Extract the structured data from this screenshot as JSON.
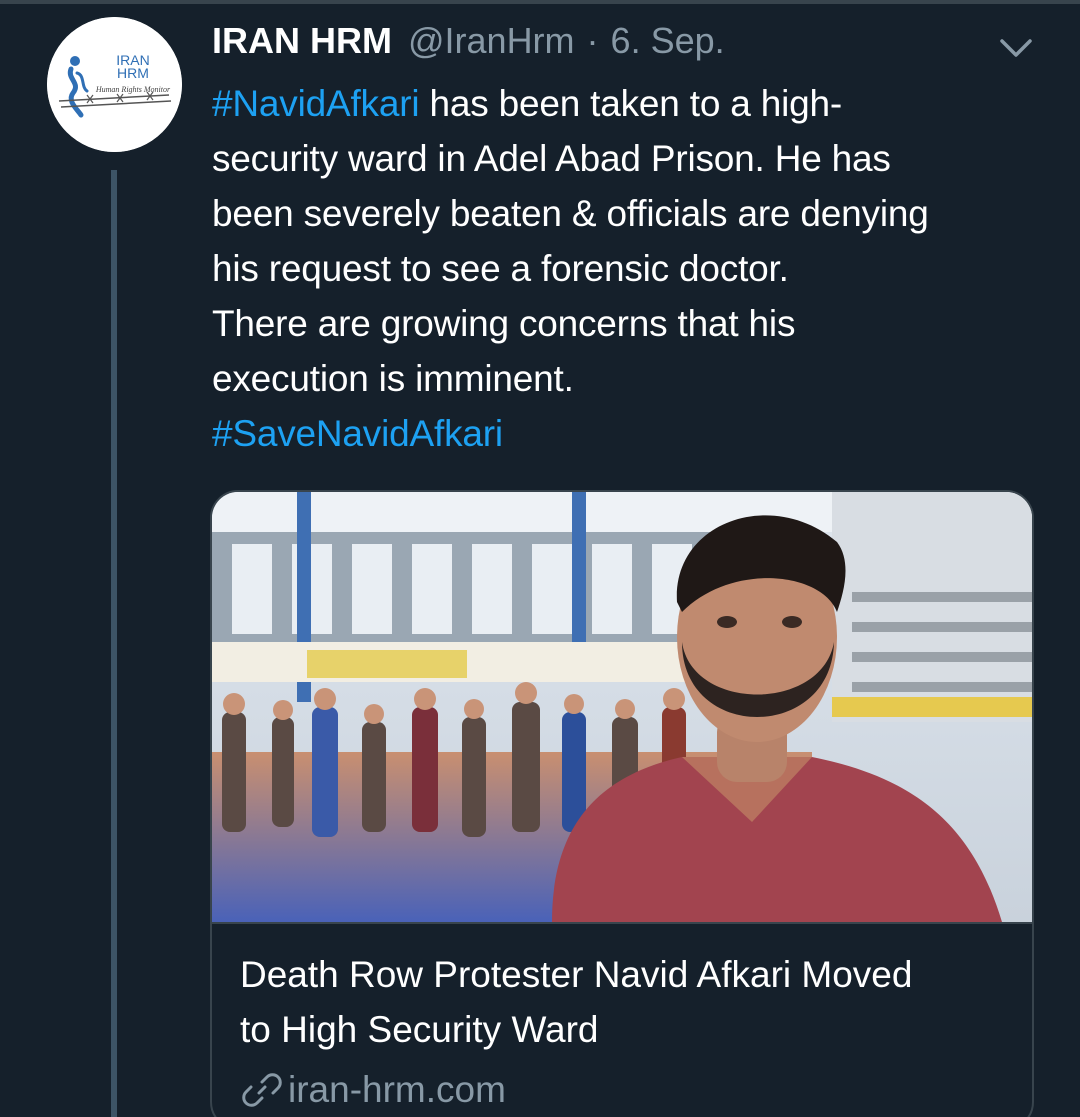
{
  "tweet": {
    "author": {
      "name": "IRAN HRM",
      "handle": "@IranHrm",
      "avatar_lines": [
        "IRAN",
        "HRM"
      ],
      "avatar_subtitle": "Human Rights Monitor"
    },
    "separator": "·",
    "date": "6. Sep.",
    "text_lines": {
      "l1_hashtag": "#NavidAfkari",
      "l1_rest": " has been taken to a high-",
      "l2": "security ward in Adel Abad Prison. He has",
      "l3": "been severely beaten & officials are denying",
      "l4": "his request to see a forensic doctor.",
      "l5": "There are growing concerns that his",
      "l6": "execution is imminent.",
      "l7_hashtag": "#SaveNavidAfkari"
    },
    "card": {
      "title_lines": [
        "Death Row Protester Navid Afkari Moved",
        "to High Security Ward"
      ],
      "domain": "iran-hrm.com",
      "image": "photo of a man in a red t-shirt in a wrestling gym"
    }
  },
  "icons": {
    "menu": "chevron-down-icon",
    "link": "link-icon"
  },
  "colors": {
    "background": "#15202b",
    "text": "#ffffff",
    "secondary": "#8899a6",
    "hashtag": "#1da1f2",
    "border": "#38444d",
    "thread_line": "#3d5466"
  }
}
